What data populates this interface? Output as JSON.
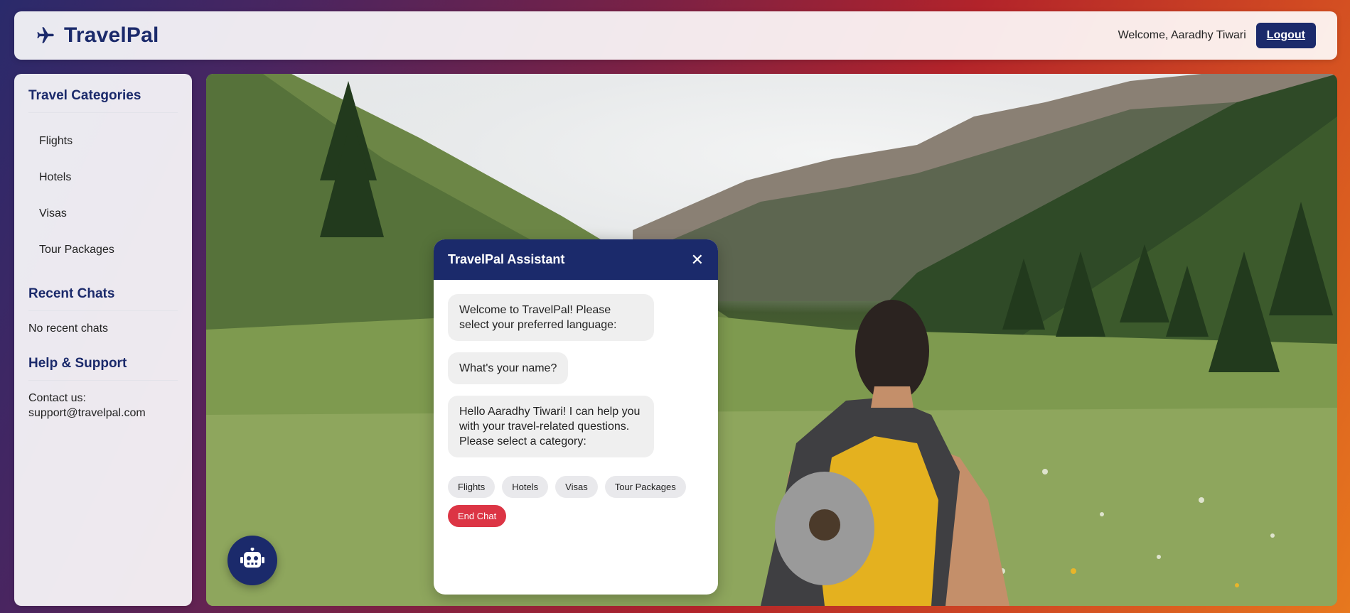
{
  "header": {
    "brand_icon": "airplane-icon",
    "brand_name": "TravelPal",
    "welcome_text": "Welcome, Aaradhy Tiwari",
    "logout_label": "Logout"
  },
  "sidebar": {
    "categories_title": "Travel Categories",
    "categories": [
      {
        "label": "Flights"
      },
      {
        "label": "Hotels"
      },
      {
        "label": "Visas"
      },
      {
        "label": "Tour Packages"
      }
    ],
    "recent_title": "Recent Chats",
    "recent_empty": "No recent chats",
    "help_title": "Help & Support",
    "contact_label": "Contact us:",
    "contact_email": "support@travelpal.com"
  },
  "chat": {
    "title": "TravelPal Assistant",
    "close_icon": "close-icon",
    "messages": [
      {
        "text": "Welcome to TravelPal! Please select your preferred language:"
      },
      {
        "text": "What's your name?"
      },
      {
        "text": "Hello Aaradhy Tiwari! I can help you with your travel-related questions. Please select a category:"
      }
    ],
    "options": [
      {
        "label": "Flights"
      },
      {
        "label": "Hotels"
      },
      {
        "label": "Visas"
      },
      {
        "label": "Tour Packages"
      }
    ],
    "end_chat_label": "End Chat"
  },
  "fab": {
    "icon": "robot-icon"
  },
  "colors": {
    "brand": "#1b2a6b",
    "danger": "#dc3545"
  }
}
